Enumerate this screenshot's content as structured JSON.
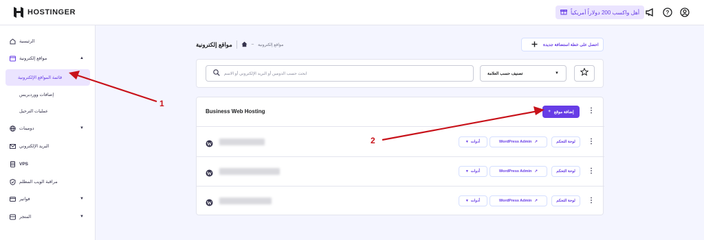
{
  "brand": {
    "name": "HOSTINGER"
  },
  "topbar": {
    "promo_label": "أهل واكسب 200 دولاراً أمريكياً",
    "icons": [
      "gift-icon",
      "megaphone-icon",
      "help-icon",
      "user-icon"
    ]
  },
  "sidebar": {
    "items": [
      {
        "label": "الرئيسية",
        "icon": "home-icon"
      },
      {
        "label": "مواقع إلكترونية",
        "icon": "websites-icon",
        "chevron": "▲"
      },
      {
        "label": "قائمة المواقع الإلكترونية",
        "active": true
      },
      {
        "label": "إضافات ووردبريس"
      },
      {
        "label": "عمليات الترحيل"
      },
      {
        "label": "دومينات",
        "icon": "globe-icon",
        "chevron": "▼"
      },
      {
        "label": "البريد الإلكتروني",
        "icon": "mail-icon"
      },
      {
        "label": "VPS",
        "icon": "server-icon"
      },
      {
        "label": "مراقبة الويب المظلم",
        "icon": "shield-icon"
      },
      {
        "label": "فواتير",
        "icon": "card-icon",
        "chevron": "▼"
      },
      {
        "label": "المتجر",
        "icon": "store-icon",
        "chevron": "▼"
      }
    ]
  },
  "header": {
    "title": "مواقع إلكترونية",
    "breadcrumb": "مواقع إلكترونية",
    "get_plan_label": "احصل على خطة استضافة جديدة"
  },
  "filters": {
    "search_placeholder": "ابحث حسب الدومين أو البريد الإلكتروني أو الاسم",
    "sort_label": "تصنيف حسب العلامة"
  },
  "plan": {
    "name": "Business Web Hosting",
    "add_site_label": "إضافة موقع"
  },
  "site_actions": {
    "tools_label": "أدوات",
    "wp_admin_label": "WordPress Admin",
    "dashboard_label": "لوحة التحكم"
  },
  "annotations": {
    "one": "1",
    "two": "2"
  },
  "colors": {
    "accent": "#673de6",
    "arrow": "#c8121a"
  }
}
